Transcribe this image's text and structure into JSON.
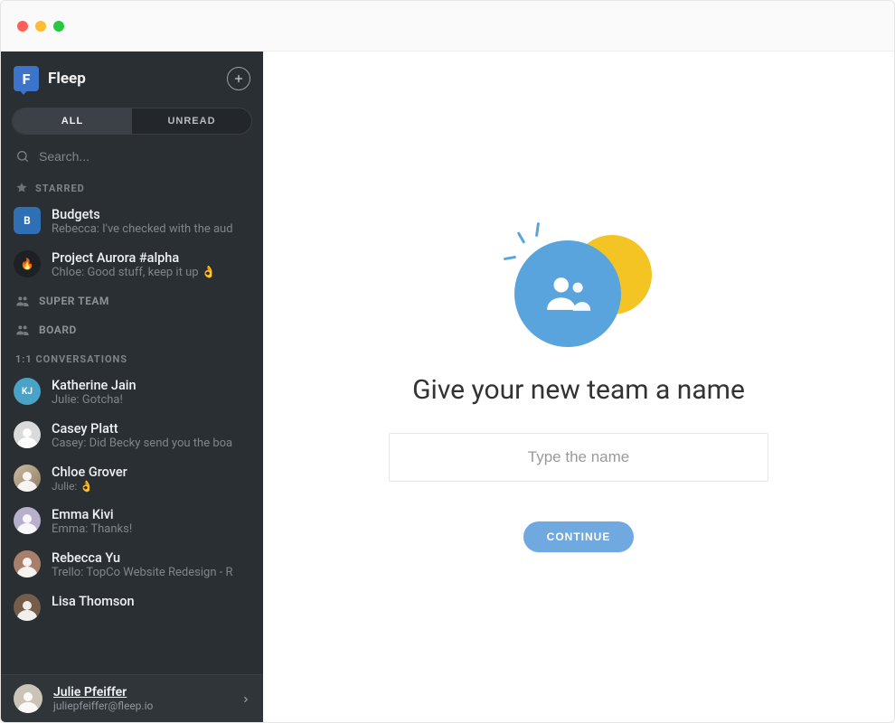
{
  "app": {
    "name": "Fleep",
    "logoLetter": "F"
  },
  "tabs": {
    "all": "All",
    "unread": "Unread",
    "active": "all"
  },
  "search": {
    "placeholder": "Search..."
  },
  "sections": {
    "starred": "Starred",
    "oneToOne": "1:1 Conversations"
  },
  "teams": [
    {
      "label": "Super Team"
    },
    {
      "label": "Board"
    }
  ],
  "starred": [
    {
      "title": "Budgets",
      "sub": "Rebecca: I've checked with the aud",
      "avatarLetter": "B"
    },
    {
      "title": "Project Aurora #alpha",
      "sub": "Chloe: Good stuff, keep it up 👌",
      "avatarLetter": "🔥"
    }
  ],
  "conversations": [
    {
      "title": "Katherine Jain",
      "sub": "Julie: Gotcha!",
      "initials": "KJ"
    },
    {
      "title": "Casey Platt",
      "sub": "Casey: Did Becky send you the boa"
    },
    {
      "title": "Chloe Grover",
      "sub": "Julie: 👌"
    },
    {
      "title": "Emma Kivi",
      "sub": "Emma: Thanks!"
    },
    {
      "title": "Rebecca Yu",
      "sub": "Trello: TopCo Website Redesign - R"
    },
    {
      "title": "Lisa Thomson",
      "sub": ""
    }
  ],
  "me": {
    "name": "Julie Pfeiffer",
    "email": "juliepfeiffer@fleep.io"
  },
  "main": {
    "headline": "Give your new team a name",
    "placeholder": "Type the name",
    "cta": "Continue"
  },
  "colors": {
    "accent": "#5aa4dd",
    "accent2": "#f3c423",
    "sidebar": "#2a2f33"
  }
}
